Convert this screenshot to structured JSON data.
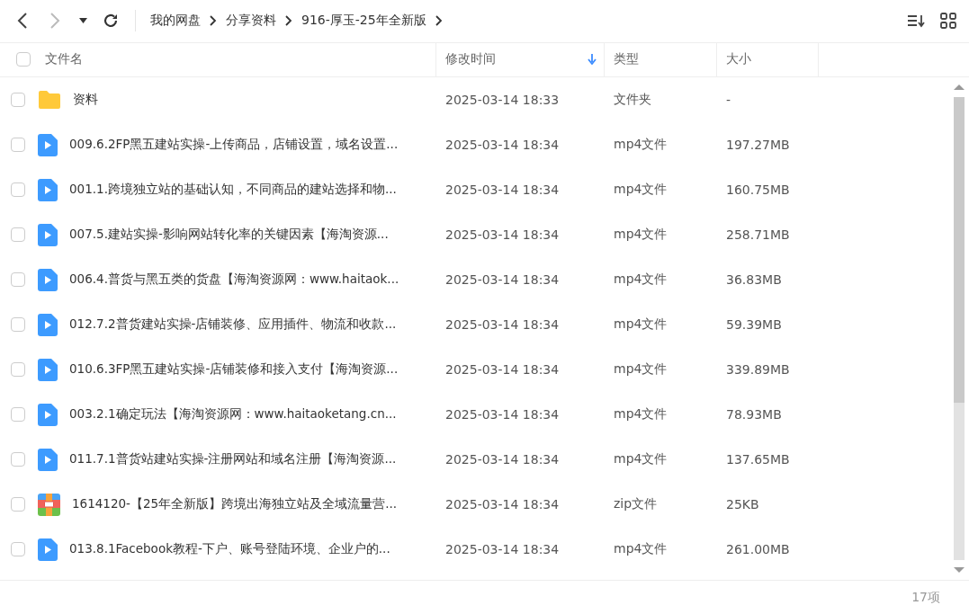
{
  "breadcrumb": [
    "我的网盘",
    "分享资料",
    "916-厚玉-25年全新版"
  ],
  "select_all": {
    "checked": false
  },
  "columns": [
    {
      "label": "文件名",
      "sorted": false
    },
    {
      "label": "修改时间",
      "sorted": true
    },
    {
      "label": "类型",
      "sorted": false
    },
    {
      "label": "大小",
      "sorted": false
    }
  ],
  "rows": [
    {
      "kind": "folder",
      "name": "资料",
      "modified": "2025-03-14 18:33",
      "type": "文件夹",
      "size": "-",
      "checked": false
    },
    {
      "kind": "video",
      "name": "009.6.2FP黑五建站实操-上传商品，店铺设置，域名设置...",
      "modified": "2025-03-14 18:34",
      "type": "mp4文件",
      "size": "197.27MB",
      "checked": false
    },
    {
      "kind": "video",
      "name": "001.1.跨境独立站的基础认知，不同商品的建站选择和物...",
      "modified": "2025-03-14 18:34",
      "type": "mp4文件",
      "size": "160.75MB",
      "checked": false
    },
    {
      "kind": "video",
      "name": "007.5.建站实操-影响网站转化率的关键因素【海淘资源...",
      "modified": "2025-03-14 18:34",
      "type": "mp4文件",
      "size": "258.71MB",
      "checked": false
    },
    {
      "kind": "video",
      "name": "006.4.普货与黑五类的货盘【海淘资源网：www.haitaok...",
      "modified": "2025-03-14 18:34",
      "type": "mp4文件",
      "size": "36.83MB",
      "checked": false
    },
    {
      "kind": "video",
      "name": "012.7.2普货建站实操-店铺装修、应用插件、物流和收款...",
      "modified": "2025-03-14 18:34",
      "type": "mp4文件",
      "size": "59.39MB",
      "checked": false
    },
    {
      "kind": "video",
      "name": "010.6.3FP黑五建站实操-店铺装修和接入支付【海淘资源...",
      "modified": "2025-03-14 18:34",
      "type": "mp4文件",
      "size": "339.89MB",
      "checked": false
    },
    {
      "kind": "video",
      "name": "003.2.1确定玩法【海淘资源网：www.haitaoketang.cn...",
      "modified": "2025-03-14 18:34",
      "type": "mp4文件",
      "size": "78.93MB",
      "checked": false
    },
    {
      "kind": "video",
      "name": "011.7.1普货站建站实操-注册网站和域名注册【海淘资源...",
      "modified": "2025-03-14 18:34",
      "type": "mp4文件",
      "size": "137.65MB",
      "checked": false
    },
    {
      "kind": "zip",
      "name": "1614120-【25年全新版】跨境出海独立站及全域流量营...",
      "modified": "2025-03-14 18:34",
      "type": "zip文件",
      "size": "25KB",
      "checked": false
    },
    {
      "kind": "video",
      "name": "013.8.1Facebook教程-下户、账号登陆环境、企业户的...",
      "modified": "2025-03-14 18:34",
      "type": "mp4文件",
      "size": "261.00MB",
      "checked": false
    }
  ],
  "status": "17项"
}
